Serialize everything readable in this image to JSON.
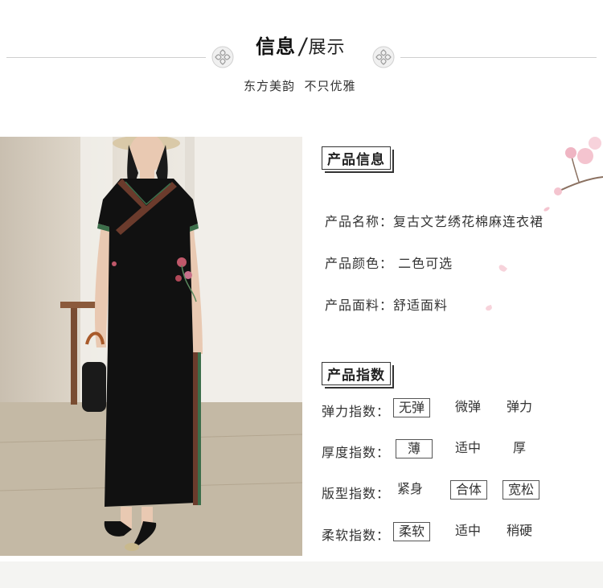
{
  "header": {
    "title_bold": "信息",
    "title_slash": "/",
    "title_light": "展示",
    "subtitle": "东方美韵  不只优雅"
  },
  "product_info": {
    "section_title": "产品信息",
    "rows": [
      {
        "label": "产品名称：",
        "value": "复古文艺绣花棉麻连衣裙"
      },
      {
        "label": "产品颜色：",
        "value": " 二色可选"
      },
      {
        "label": "产品面料：",
        "value": "舒适面料"
      }
    ]
  },
  "product_index": {
    "section_title": "产品指数",
    "rows": [
      {
        "label": "弹力指数：",
        "options": [
          "无弹",
          "微弹",
          "弹力"
        ],
        "selected": [
          "无弹"
        ]
      },
      {
        "label": "厚度指数：",
        "options": [
          "薄",
          "适中",
          "厚"
        ],
        "selected": [
          "薄"
        ]
      },
      {
        "label": "版型指数：",
        "options": [
          "紧身",
          "合体",
          "宽松"
        ],
        "selected": [
          "合体",
          "宽松"
        ]
      },
      {
        "label": "柔软指数：",
        "options": [
          "柔软",
          "适中",
          "稍硬"
        ],
        "selected": [
          "柔软"
        ]
      }
    ]
  },
  "colors": {
    "dress": "#111111",
    "trim": "#6b3b2c",
    "accent_green": "#3c6e4a",
    "blossom": "#f4c4cf"
  }
}
